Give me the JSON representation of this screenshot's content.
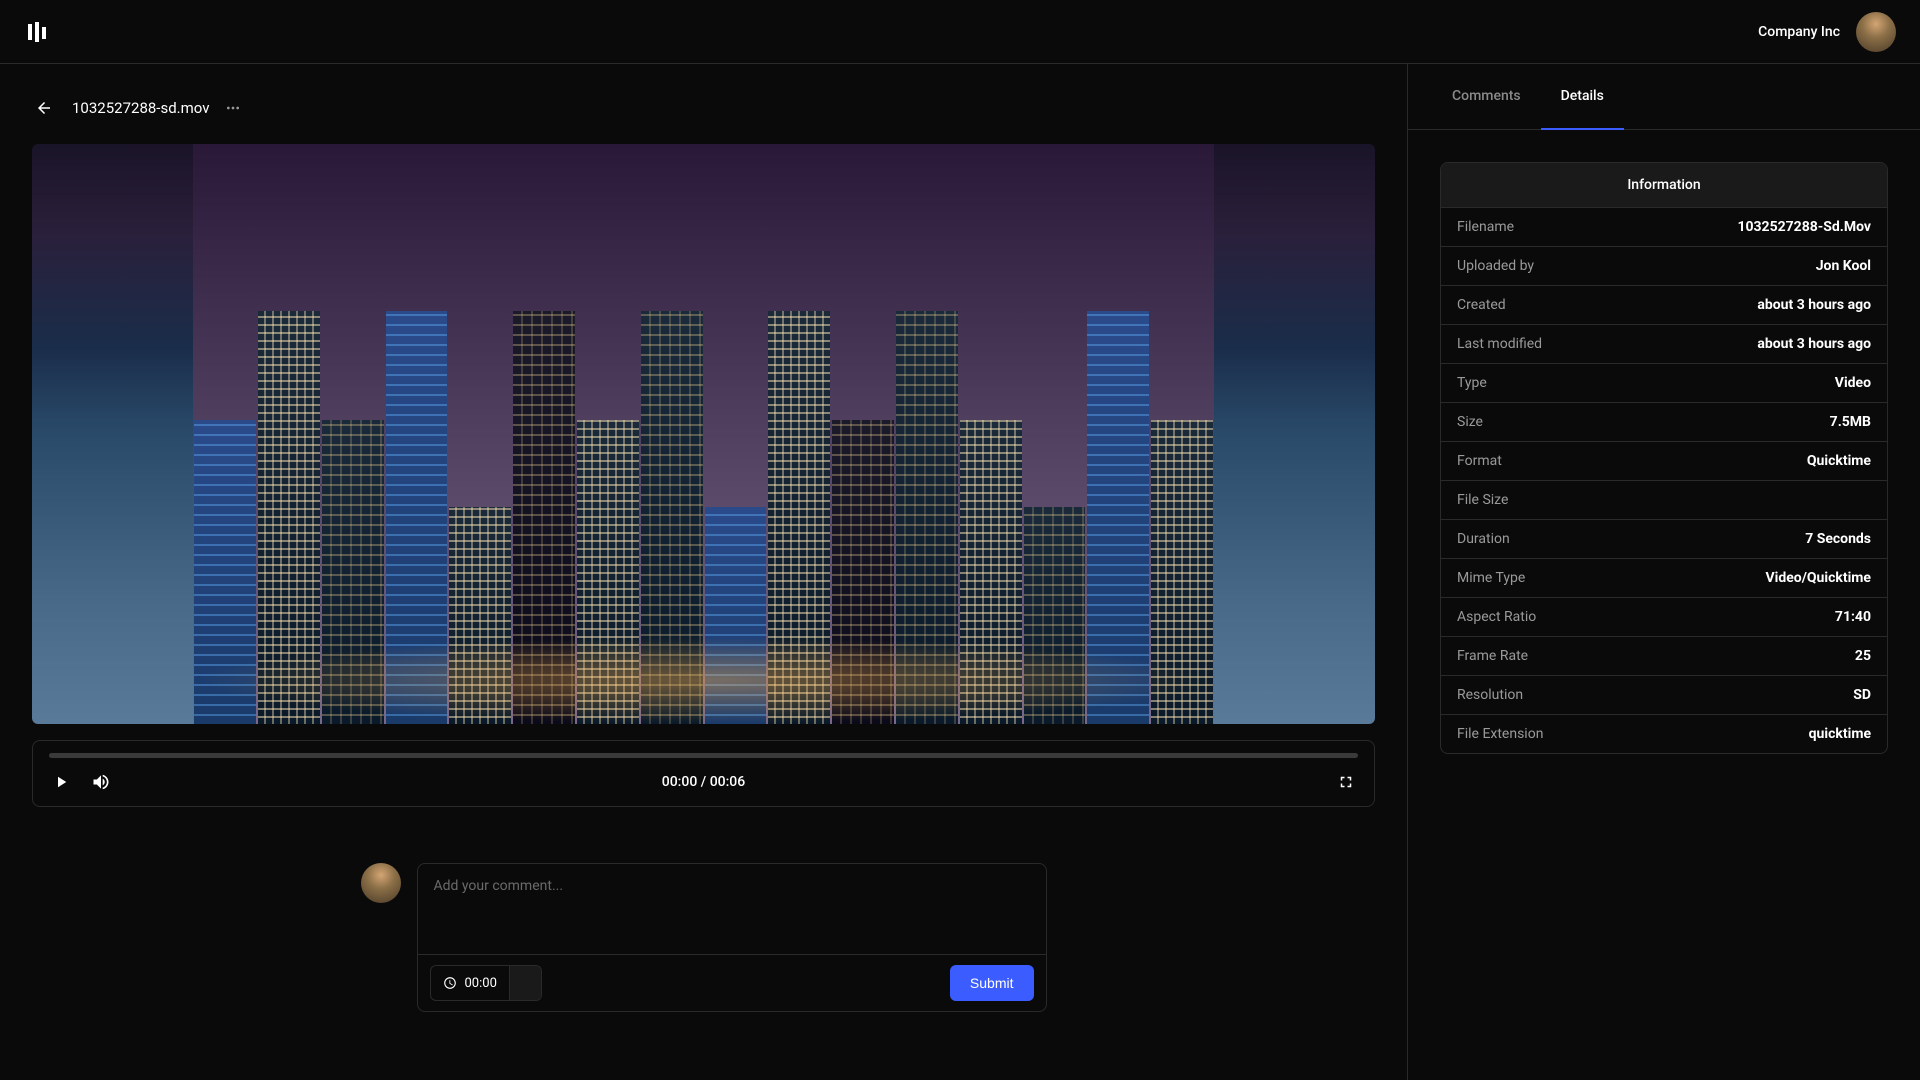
{
  "header": {
    "company": "Company Inc"
  },
  "content": {
    "filename": "1032527288-sd.mov",
    "currentTime": "00:00",
    "duration": "00:06",
    "timeDisplay": "00:00 / 00:06"
  },
  "comment": {
    "placeholder": "Add your comment...",
    "timestamp": "00:00",
    "submitLabel": "Submit"
  },
  "tabs": {
    "comments": "Comments",
    "details": "Details"
  },
  "info": {
    "title": "Information",
    "rows": [
      {
        "label": "Filename",
        "value": "1032527288-Sd.Mov"
      },
      {
        "label": "Uploaded by",
        "value": "Jon Kool"
      },
      {
        "label": "Created",
        "value": "about 3 hours ago"
      },
      {
        "label": "Last modified",
        "value": "about 3 hours ago"
      },
      {
        "label": "Type",
        "value": "Video"
      },
      {
        "label": "Size",
        "value": "7.5MB"
      },
      {
        "label": "Format",
        "value": "Quicktime"
      },
      {
        "label": "File Size",
        "value": ""
      },
      {
        "label": "Duration",
        "value": "7 Seconds"
      },
      {
        "label": "Mime Type",
        "value": "Video/Quicktime"
      },
      {
        "label": "Aspect Ratio",
        "value": "71:40"
      },
      {
        "label": "Frame Rate",
        "value": "25"
      },
      {
        "label": "Resolution",
        "value": "SD"
      },
      {
        "label": "File Extension",
        "value": "quicktime"
      }
    ]
  }
}
